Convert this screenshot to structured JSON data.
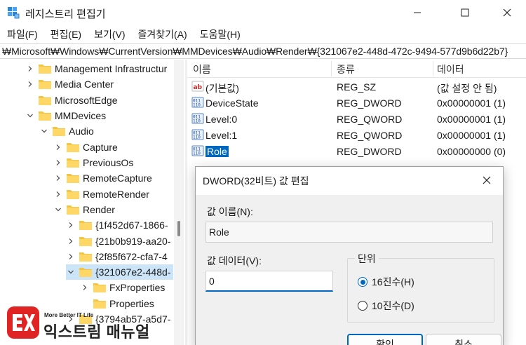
{
  "window": {
    "title": "레지스트리 편집기"
  },
  "menu": [
    "파일(F)",
    "편집(E)",
    "보기(V)",
    "즐겨찾기(A)",
    "도움말(H)"
  ],
  "address": "₩Microsoft₩Windows₩CurrentVersion₩MMDevices₩Audio₩Render₩{321067e2-448d-472c-9494-577d9b6d22b7}",
  "tree": [
    {
      "label": "Management Infrastructur",
      "expanded": false,
      "selected": false
    },
    {
      "label": "Media Center",
      "expanded": false,
      "selected": false
    },
    {
      "label": "MicrosoftEdge",
      "expanded": false,
      "selected": false
    },
    {
      "label": "MMDevices",
      "expanded": true,
      "selected": false
    },
    {
      "label": "Audio",
      "expanded": true,
      "selected": false
    },
    {
      "label": "Capture",
      "expanded": false,
      "selected": false
    },
    {
      "label": "PreviousOs",
      "expanded": false,
      "selected": false
    },
    {
      "label": "RemoteCapture",
      "expanded": false,
      "selected": false
    },
    {
      "label": "RemoteRender",
      "expanded": false,
      "selected": false
    },
    {
      "label": "Render",
      "expanded": true,
      "selected": false
    },
    {
      "label": "{1f452d67-1866-",
      "expanded": false,
      "selected": false
    },
    {
      "label": "{21b0b919-aa20-",
      "expanded": false,
      "selected": false
    },
    {
      "label": "{2f85f672-cfa7-4",
      "expanded": false,
      "selected": false
    },
    {
      "label": "{321067e2-448d-",
      "expanded": true,
      "selected": true
    },
    {
      "label": "FxProperties",
      "expanded": false,
      "selected": false
    },
    {
      "label": "Properties",
      "expanded": false,
      "selected": false
    },
    {
      "label": "{3794ab57-a5d7-",
      "expanded": false,
      "selected": false
    }
  ],
  "list": {
    "columns": [
      "이름",
      "종류",
      "데이터"
    ],
    "rows": [
      {
        "name": "(기본값)",
        "type": "REG_SZ",
        "data": "(값 설정 안 됨)",
        "icon": "string-value-icon"
      },
      {
        "name": "DeviceState",
        "type": "REG_DWORD",
        "data": "0x00000001 (1)",
        "icon": "binary-value-icon"
      },
      {
        "name": "Level:0",
        "type": "REG_QWORD",
        "data": "0x00000001 (1)",
        "icon": "binary-value-icon"
      },
      {
        "name": "Level:1",
        "type": "REG_QWORD",
        "data": "0x00000001 (1)",
        "icon": "binary-value-icon"
      },
      {
        "name": "Role",
        "type": "REG_DWORD",
        "data": "0x00000000 (0)",
        "icon": "binary-value-icon",
        "selected": true
      }
    ]
  },
  "dialog": {
    "title": "DWORD(32비트) 값 편집",
    "value_name_label": "값 이름(N):",
    "value_name": "Role",
    "value_data_label": "값 데이터(V):",
    "value_data": "0",
    "base_label": "단위",
    "radio_hex": "16진수(H)",
    "radio_dec": "10진수(D)",
    "selected_base": "hex",
    "ok_label": "확인",
    "cancel_label": "취소"
  },
  "watermark": {
    "small": "More Better IT Life",
    "big": "익스트림 매뉴얼"
  },
  "colors": {
    "accent": "#0067c0",
    "folder": "#f4c542",
    "watermark": "#e02424"
  }
}
